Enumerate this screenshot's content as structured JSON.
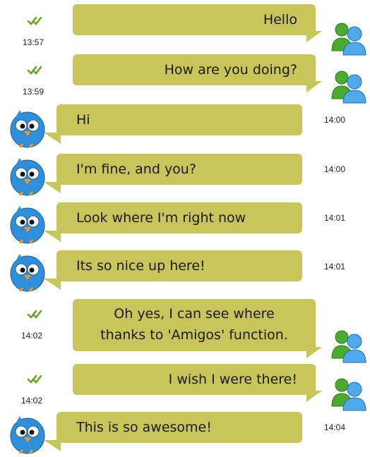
{
  "colors": {
    "bubble": "#c8c55a",
    "text": "#1a1a1a",
    "check": "#6aa32a",
    "bird_body": "#2f8fd8",
    "contact_green": "#4caa2e",
    "contact_blue": "#2e8fd8"
  },
  "icons": {
    "sent": "double-check-icon",
    "self_avatar": "contacts-icon",
    "peer_avatar": "bird-avatar-icon"
  },
  "messages": [
    {
      "direction": "out",
      "lines": [
        "Hello"
      ],
      "time": "13:57"
    },
    {
      "direction": "out",
      "lines": [
        "How are you doing?"
      ],
      "time": "13:59"
    },
    {
      "direction": "in",
      "lines": [
        "Hi"
      ],
      "time": "14:00"
    },
    {
      "direction": "in",
      "lines": [
        "I'm fine, and you?"
      ],
      "time": "14:00"
    },
    {
      "direction": "in",
      "lines": [
        "Look where I'm right now"
      ],
      "time": "14:01"
    },
    {
      "direction": "in",
      "lines": [
        "Its so nice up here!"
      ],
      "time": "14:01"
    },
    {
      "direction": "out",
      "lines": [
        "Oh yes, I can see where",
        "thanks to 'Amigos' function."
      ],
      "time": "14:02"
    },
    {
      "direction": "out",
      "lines": [
        "I wish I  were there!"
      ],
      "time": "14:02"
    },
    {
      "direction": "in",
      "lines": [
        "This is so awesome!"
      ],
      "time": "14:04"
    }
  ]
}
